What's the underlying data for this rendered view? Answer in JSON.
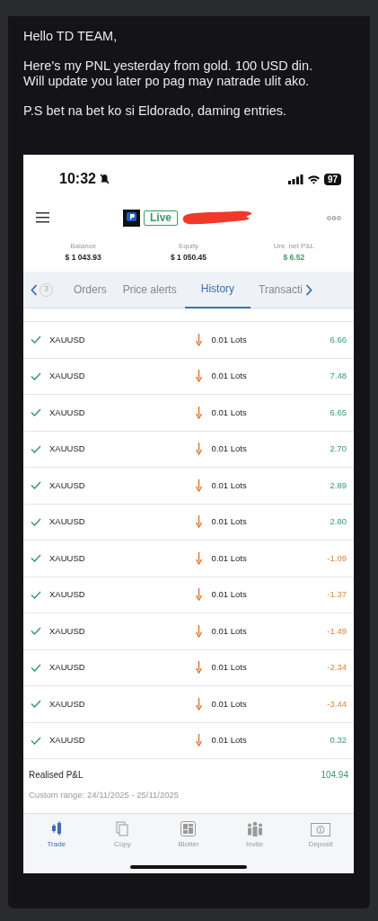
{
  "message": {
    "greeting": "Hello TD TEAM,",
    "lines": [
      "Here's my PNL  yesterday from gold. 100 USD din.",
      "Will update you later po pag may natrade ulit ako."
    ],
    "ps": "P.S bet na bet ko si Eldorado, daming entries."
  },
  "phone": {
    "time": "10:32",
    "battery": "97",
    "header": {
      "badge": "Live"
    },
    "account": [
      {
        "label": "Balance",
        "value": "$ 1 043.93",
        "color": "#222222"
      },
      {
        "label": "Equity",
        "value": "$ 1 050.45",
        "color": "#222222"
      },
      {
        "label": "Unr. net P&L",
        "value": "$ 6.52",
        "color": "#3a9a6a"
      }
    ],
    "tabs": [
      {
        "label": "3",
        "kind": "count",
        "selected": false
      },
      {
        "label": "Orders",
        "kind": "tab",
        "selected": false
      },
      {
        "label": "Price alerts",
        "kind": "tab",
        "selected": false
      },
      {
        "label": "History",
        "kind": "tab",
        "selected": true
      },
      {
        "label": "Transacti",
        "kind": "tab",
        "selected": false
      }
    ],
    "rows": [
      {
        "symbol": "XAUUSD",
        "lots": "0.01 Lots",
        "pnl": "6.66",
        "kind": "profit"
      },
      {
        "symbol": "XAUUSD",
        "lots": "0.01 Lots",
        "pnl": "7.48",
        "kind": "profit"
      },
      {
        "symbol": "XAUUSD",
        "lots": "0.01 Lots",
        "pnl": "6.65",
        "kind": "profit"
      },
      {
        "symbol": "XAUUSD",
        "lots": "0.01 Lots",
        "pnl": "2.70",
        "kind": "profit"
      },
      {
        "symbol": "XAUUSD",
        "lots": "0.01 Lots",
        "pnl": "2.89",
        "kind": "profit"
      },
      {
        "symbol": "XAUUSD",
        "lots": "0.01 Lots",
        "pnl": "2.80",
        "kind": "profit"
      },
      {
        "symbol": "XAUUSD",
        "lots": "0.01 Lots",
        "pnl": "-1.09",
        "kind": "loss"
      },
      {
        "symbol": "XAUUSD",
        "lots": "0.01 Lots",
        "pnl": "-1.37",
        "kind": "loss"
      },
      {
        "symbol": "XAUUSD",
        "lots": "0.01 Lots",
        "pnl": "-1.49",
        "kind": "loss"
      },
      {
        "symbol": "XAUUSD",
        "lots": "0.01 Lots",
        "pnl": "-2.34",
        "kind": "loss"
      },
      {
        "symbol": "XAUUSD",
        "lots": "0.01 Lots",
        "pnl": "-3.44",
        "kind": "loss"
      },
      {
        "symbol": "XAUUSD",
        "lots": "0.01 Lots",
        "pnl": "0.32",
        "kind": "profit"
      }
    ],
    "summary": {
      "label": "Realised P&L",
      "value": "104.94",
      "range": "Custom range: 24/11/2025 - 25/11/2025"
    },
    "nav": [
      {
        "label": "Trade",
        "kind": "trade",
        "selected": true
      },
      {
        "label": "Copy",
        "kind": "copy",
        "selected": false
      },
      {
        "label": "Blotter",
        "kind": "blotter",
        "selected": false
      },
      {
        "label": "Invite",
        "kind": "invite",
        "selected": false
      },
      {
        "label": "Deposit",
        "kind": "deposit",
        "selected": false
      }
    ]
  }
}
